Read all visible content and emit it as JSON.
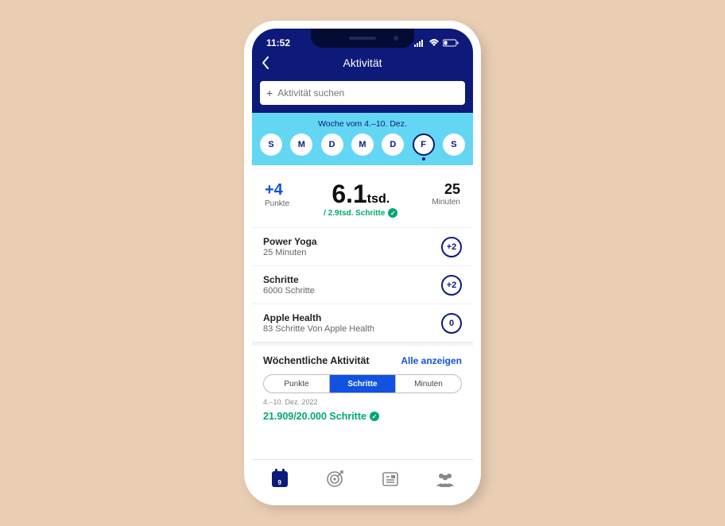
{
  "status": {
    "time": "11:52"
  },
  "header": {
    "title": "Aktivität"
  },
  "search": {
    "placeholder": "Aktivität suchen"
  },
  "week": {
    "label": "Woche vom 4.–10. Dez.",
    "days": [
      "S",
      "M",
      "D",
      "M",
      "D",
      "F",
      "S"
    ],
    "selected_index": 5
  },
  "summary": {
    "points_value": "+4",
    "points_label": "Punkte",
    "steps_value": "6.1",
    "steps_unit": "tsd.",
    "steps_goal": "/ 2.9tsd. Schritte",
    "minutes_value": "25",
    "minutes_label": "Minuten"
  },
  "activities": [
    {
      "title": "Power Yoga",
      "sub": "25 Minuten",
      "badge": "+2"
    },
    {
      "title": "Schritte",
      "sub": "6000 Schritte",
      "badge": "+2"
    },
    {
      "title": "Apple Health",
      "sub": "83 Schritte Von Apple Health",
      "badge": "0"
    }
  ],
  "weekly": {
    "title": "Wöchentliche Aktivität",
    "show_all": "Alle anzeigen",
    "segments": [
      "Punkte",
      "Schritte",
      "Minuten"
    ],
    "active_segment": 1,
    "date_range": "4.–10. Dez. 2022",
    "progress": "21.909/20.000 Schritte"
  },
  "nav": {
    "calendar_day": "9"
  }
}
